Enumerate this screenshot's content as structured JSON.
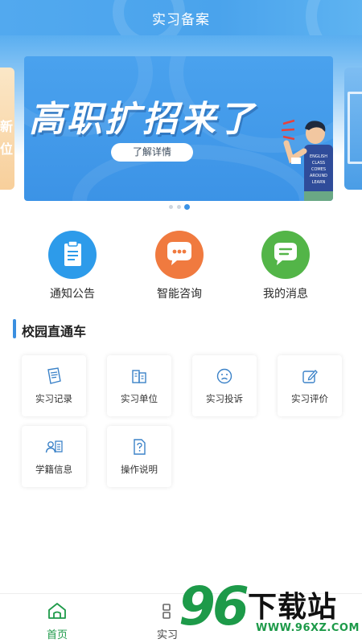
{
  "header": {
    "title": "实习备案"
  },
  "banner": {
    "headline": "高职扩招来了",
    "button_label": "了解详情",
    "shirt_text": "ENGLISH CLASS COMES AROUND LEARN",
    "left_peek_text": "新 位",
    "dot_count": 3,
    "active_dot": 2
  },
  "quick_actions": [
    {
      "label": "通知公告",
      "icon": "clipboard-icon",
      "color": "#2d9bea"
    },
    {
      "label": "智能咨询",
      "icon": "chat-bubble-icon",
      "color": "#f07a3f"
    },
    {
      "label": "我的消息",
      "icon": "message-icon",
      "color": "#53b548"
    }
  ],
  "section": {
    "title": "校园直通车",
    "tiles": [
      {
        "label": "实习记录",
        "icon": "record-icon"
      },
      {
        "label": "实习单位",
        "icon": "building-icon"
      },
      {
        "label": "实习投诉",
        "icon": "frown-face-icon"
      },
      {
        "label": "实习评价",
        "icon": "edit-icon"
      },
      {
        "label": "学籍信息",
        "icon": "student-id-icon"
      },
      {
        "label": "操作说明",
        "icon": "document-help-icon"
      }
    ]
  },
  "bottom_nav": [
    {
      "label": "首页",
      "icon": "home-icon",
      "active": true
    },
    {
      "label": "实习",
      "icon": "grid-icon",
      "active": false
    }
  ],
  "watermark": {
    "big": "96",
    "cn": "下载站",
    "url": "WWW.96XZ.COM"
  },
  "colors": {
    "primary": "#3c93e6",
    "active_nav": "#1d9a49"
  }
}
